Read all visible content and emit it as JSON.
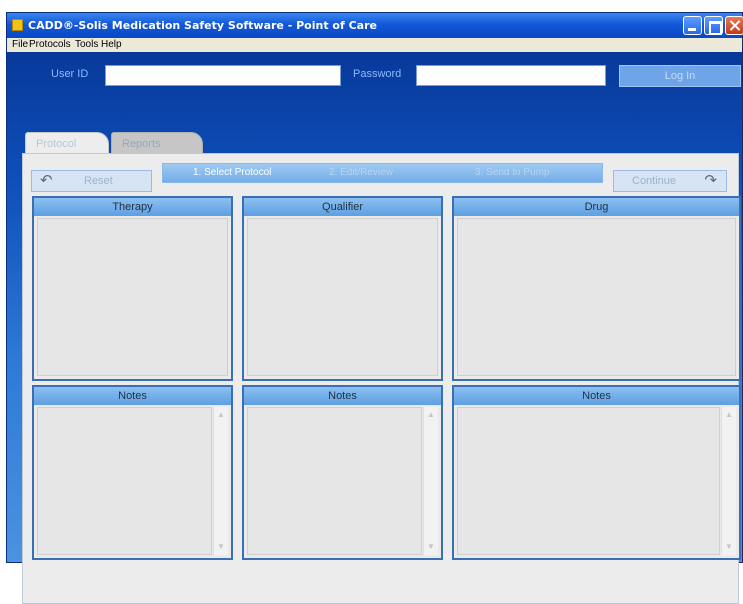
{
  "window": {
    "title": "CADD®-Solis Medication Safety Software - Point of Care"
  },
  "menu": [
    "File",
    "Protocols",
    "Tools",
    "Help"
  ],
  "login": {
    "user_id_label": "User ID",
    "user_id_value": "",
    "password_label": "Password",
    "password_value": "",
    "login_button": "Log In"
  },
  "tabs": [
    "Protocol",
    "Reports"
  ],
  "toolbar": {
    "reset_label": "Reset",
    "continue_label": "Continue",
    "steps": [
      "1. Select Protocol",
      "2. Edit/Review",
      "3. Send to Pump"
    ]
  },
  "columns": {
    "therapy": "Therapy",
    "qualifier": "Qualifier",
    "drug": "Drug"
  },
  "notes": [
    "Notes",
    "Notes",
    "Notes"
  ],
  "icons": {
    "reset": "undo-arrow-icon",
    "continue": "redo-arrow-icon",
    "scroll_up": "scroll-up-icon",
    "scroll_down": "scroll-down-icon"
  }
}
